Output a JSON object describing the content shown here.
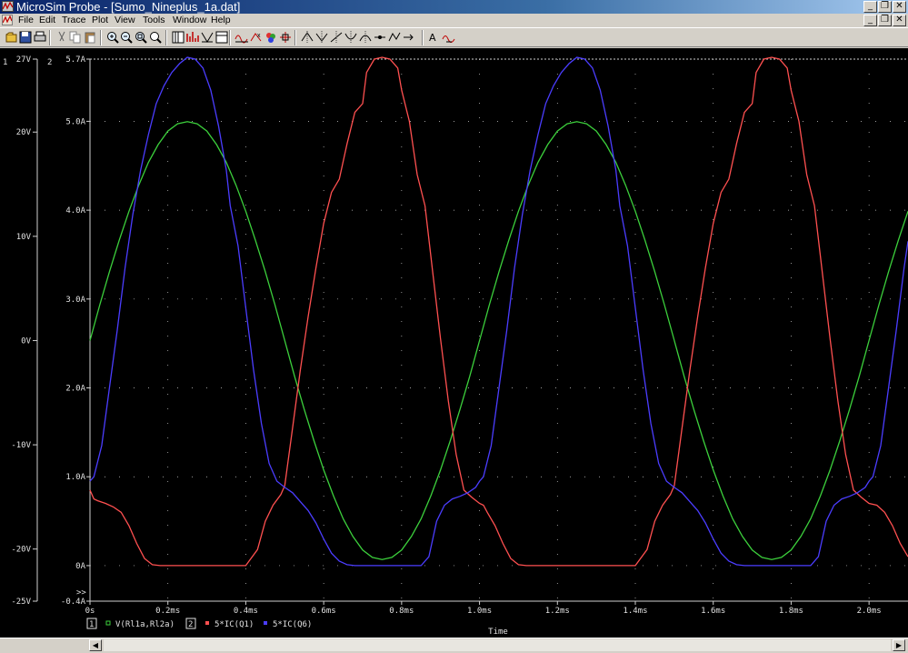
{
  "window": {
    "title": "MicroSim Probe - [Sumo_Nineplus_1a.dat]",
    "controls": [
      "_",
      "❐",
      "✕"
    ]
  },
  "menu": {
    "items": [
      "File",
      "Edit",
      "Trace",
      "Plot",
      "View",
      "Tools",
      "Window",
      "Help"
    ]
  },
  "toolbar": {
    "icons": [
      "open-icon",
      "save-icon",
      "print-icon",
      "cut-icon",
      "copy-icon",
      "paste-icon",
      "zoom-in-icon",
      "zoom-out-icon",
      "zoom-area-icon",
      "zoom-fit-icon",
      "log-x-icon",
      "fourier-icon",
      "performance-icon",
      "axis-settings-icon",
      "add-trace-icon",
      "eval-goal-icon",
      "color-icon",
      "toggle-cursor-icon",
      "cursor-peak-icon",
      "cursor-trough-icon",
      "cursor-slope-icon",
      "cursor-min-icon",
      "cursor-max-icon",
      "cursor-point-icon",
      "cursor-search-icon",
      "cursor-next-icon",
      "mark-label-icon",
      "mark-data-icon"
    ]
  },
  "colors": {
    "background": "#000000",
    "grid": "#cfcfcf",
    "green": "#3cd03c",
    "red": "#ff5050",
    "blue": "#4b3dff",
    "axis_text": "#e0e0e0"
  },
  "chart_data": {
    "type": "line",
    "xlabel": "Time",
    "x_unit": "ms",
    "xlim": [
      0,
      2.1
    ],
    "x_ticks": [
      "0s",
      "0.2ms",
      "0.4ms",
      "0.6ms",
      "0.8ms",
      "1.0ms",
      "1.2ms",
      "1.4ms",
      "1.6ms",
      "1.8ms",
      "2.0ms"
    ],
    "axis_1": {
      "number": "1",
      "ylim": [
        -25,
        27
      ],
      "ticks": [
        "27V",
        "20V",
        "10V",
        "0V",
        "-10V",
        "-20V",
        "-25V"
      ]
    },
    "axis_2": {
      "number": "2",
      "ylim": [
        -0.4,
        5.7
      ],
      "ticks": [
        "5.7A",
        "5.0A",
        "4.0A",
        "3.0A",
        "2.0A",
        "1.0A",
        "0A",
        "-0.4A"
      ]
    },
    "series": [
      {
        "name": "V(Rl1a,Rl2a)",
        "axis": "1",
        "x": [
          0,
          0.025,
          0.05,
          0.075,
          0.1,
          0.125,
          0.15,
          0.175,
          0.2,
          0.225,
          0.25,
          0.275,
          0.3,
          0.325,
          0.35,
          0.375,
          0.4,
          0.425,
          0.45,
          0.475,
          0.5,
          0.525,
          0.55,
          0.575,
          0.6,
          0.625,
          0.65,
          0.675,
          0.7,
          0.725,
          0.75,
          0.775,
          0.8,
          0.825,
          0.85,
          0.875,
          0.9,
          0.925,
          0.95,
          0.975,
          1.0,
          1.025,
          1.05,
          1.075,
          1.1,
          1.125,
          1.15,
          1.175,
          1.2,
          1.225,
          1.25,
          1.275,
          1.3,
          1.325,
          1.35,
          1.375,
          1.4,
          1.425,
          1.45,
          1.475,
          1.5,
          1.525,
          1.55,
          1.575,
          1.6,
          1.625,
          1.65,
          1.675,
          1.7,
          1.725,
          1.75,
          1.775,
          1.8,
          1.825,
          1.85,
          1.875,
          1.9,
          1.925,
          1.95,
          1.975,
          2.0,
          2.025,
          2.05,
          2.075,
          2.1
        ],
        "y": [
          0.0,
          3.4,
          6.6,
          9.6,
          12.4,
          14.9,
          17.1,
          18.8,
          20.1,
          20.8,
          21.0,
          20.8,
          20.1,
          18.8,
          17.1,
          14.9,
          12.4,
          9.6,
          6.6,
          3.4,
          0.0,
          -3.4,
          -6.6,
          -9.6,
          -12.4,
          -14.9,
          -17.1,
          -18.8,
          -20.1,
          -20.8,
          -21.0,
          -20.8,
          -20.1,
          -18.8,
          -17.1,
          -14.9,
          -12.4,
          -9.6,
          -6.6,
          -3.4,
          0.0,
          3.4,
          6.6,
          9.6,
          12.4,
          14.9,
          17.1,
          18.8,
          20.1,
          20.8,
          21.0,
          20.8,
          20.1,
          18.8,
          17.1,
          14.9,
          12.4,
          9.6,
          6.6,
          3.4,
          0.0,
          -3.4,
          -6.6,
          -9.6,
          -12.4,
          -14.9,
          -17.1,
          -18.8,
          -20.1,
          -20.8,
          -21.0,
          -20.8,
          -20.1,
          -18.8,
          -17.1,
          -14.9,
          -12.4,
          -9.6,
          -6.6,
          -3.4,
          0.0,
          3.4,
          6.6,
          9.6,
          12.4
        ]
      },
      {
        "name": "5*IC(Q1)",
        "axis": "2",
        "x": [
          0,
          0.01,
          0.02,
          0.04,
          0.06,
          0.08,
          0.1,
          0.12,
          0.14,
          0.16,
          0.18,
          0.2,
          0.25,
          0.3,
          0.35,
          0.4,
          0.43,
          0.45,
          0.47,
          0.49,
          0.5,
          0.52,
          0.54,
          0.56,
          0.58,
          0.6,
          0.62,
          0.64,
          0.66,
          0.68,
          0.7,
          0.71,
          0.73,
          0.75,
          0.77,
          0.79,
          0.8,
          0.82,
          0.84,
          0.86,
          0.88,
          0.9,
          0.92,
          0.94,
          0.96,
          0.98,
          1.0,
          1.01,
          1.02,
          1.04,
          1.06,
          1.08,
          1.1,
          1.12,
          1.14,
          1.16,
          1.18,
          1.2,
          1.25,
          1.3,
          1.35,
          1.4,
          1.43,
          1.45,
          1.47,
          1.49,
          1.5,
          1.52,
          1.54,
          1.56,
          1.58,
          1.6,
          1.62,
          1.64,
          1.66,
          1.68,
          1.7,
          1.71,
          1.73,
          1.75,
          1.77,
          1.79,
          1.8,
          1.82,
          1.84,
          1.86,
          1.88,
          1.9,
          1.92,
          1.94,
          1.96,
          1.98,
          2.0,
          2.02,
          2.04,
          2.06,
          2.08,
          2.1
        ],
        "y": [
          0.85,
          0.75,
          0.73,
          0.7,
          0.66,
          0.6,
          0.45,
          0.25,
          0.08,
          0.01,
          0.0,
          0.0,
          0.0,
          0.0,
          0.0,
          0.0,
          0.18,
          0.5,
          0.68,
          0.8,
          0.9,
          1.55,
          2.2,
          2.8,
          3.35,
          3.85,
          4.2,
          4.35,
          4.75,
          5.1,
          5.2,
          5.55,
          5.7,
          5.72,
          5.7,
          5.6,
          5.35,
          5.0,
          4.4,
          4.05,
          3.3,
          2.55,
          1.85,
          1.25,
          0.85,
          0.77,
          0.7,
          0.68,
          0.6,
          0.45,
          0.25,
          0.08,
          0.01,
          0.0,
          0.0,
          0.0,
          0.0,
          0.0,
          0.0,
          0.0,
          0.0,
          0.0,
          0.18,
          0.5,
          0.68,
          0.8,
          0.9,
          1.55,
          2.2,
          2.8,
          3.35,
          3.85,
          4.2,
          4.35,
          4.75,
          5.1,
          5.2,
          5.55,
          5.7,
          5.72,
          5.7,
          5.6,
          5.35,
          5.0,
          4.4,
          4.05,
          3.3,
          2.55,
          1.85,
          1.25,
          0.85,
          0.77,
          0.7,
          0.68,
          0.6,
          0.45,
          0.25,
          0.1
        ]
      },
      {
        "name": "5*IC(Q6)",
        "axis": "2",
        "x": [
          0,
          0.01,
          0.03,
          0.05,
          0.07,
          0.09,
          0.11,
          0.13,
          0.15,
          0.17,
          0.19,
          0.21,
          0.23,
          0.25,
          0.27,
          0.29,
          0.31,
          0.33,
          0.35,
          0.36,
          0.38,
          0.4,
          0.42,
          0.44,
          0.46,
          0.48,
          0.5,
          0.52,
          0.54,
          0.56,
          0.58,
          0.6,
          0.62,
          0.64,
          0.66,
          0.68,
          0.7,
          0.75,
          0.8,
          0.85,
          0.87,
          0.89,
          0.91,
          0.93,
          0.95,
          0.97,
          0.99,
          1.0,
          1.01,
          1.03,
          1.05,
          1.07,
          1.09,
          1.11,
          1.13,
          1.15,
          1.17,
          1.19,
          1.21,
          1.23,
          1.25,
          1.27,
          1.29,
          1.31,
          1.33,
          1.35,
          1.36,
          1.38,
          1.4,
          1.42,
          1.44,
          1.46,
          1.48,
          1.5,
          1.52,
          1.54,
          1.56,
          1.58,
          1.6,
          1.62,
          1.64,
          1.66,
          1.68,
          1.7,
          1.75,
          1.8,
          1.85,
          1.87,
          1.89,
          1.91,
          1.93,
          1.95,
          1.97,
          1.99,
          2.0,
          2.01,
          2.03,
          2.05,
          2.07,
          2.09,
          2.1
        ],
        "y": [
          0.95,
          1.0,
          1.35,
          2.0,
          2.65,
          3.35,
          3.95,
          4.45,
          4.85,
          5.2,
          5.4,
          5.55,
          5.65,
          5.72,
          5.7,
          5.6,
          5.35,
          4.95,
          4.45,
          4.05,
          3.6,
          2.9,
          2.2,
          1.6,
          1.15,
          0.95,
          0.88,
          0.82,
          0.72,
          0.62,
          0.48,
          0.3,
          0.14,
          0.05,
          0.01,
          0.0,
          0.0,
          0.0,
          0.0,
          0.0,
          0.1,
          0.5,
          0.68,
          0.75,
          0.78,
          0.82,
          0.88,
          0.95,
          1.0,
          1.35,
          2.0,
          2.65,
          3.35,
          3.95,
          4.45,
          4.85,
          5.2,
          5.4,
          5.55,
          5.65,
          5.72,
          5.7,
          5.6,
          5.35,
          4.95,
          4.45,
          4.05,
          3.6,
          2.9,
          2.2,
          1.6,
          1.15,
          0.95,
          0.88,
          0.82,
          0.72,
          0.62,
          0.48,
          0.3,
          0.14,
          0.05,
          0.01,
          0.0,
          0.0,
          0.0,
          0.0,
          0.0,
          0.1,
          0.5,
          0.68,
          0.75,
          0.78,
          0.82,
          0.88,
          0.95,
          1.0,
          1.35,
          2.0,
          2.65,
          3.35,
          3.65
        ]
      }
    ],
    "legend_position": "bottom-left",
    "legend_prefix": ">>",
    "grid": true
  }
}
